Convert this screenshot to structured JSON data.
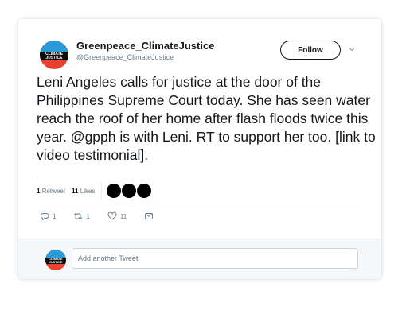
{
  "tweet": {
    "author": {
      "display_name": "Greenpeace_ClimateJustice",
      "handle": "@Greenpeace_ClimateJustice",
      "avatar_text": "CLIMATE JUSTICE"
    },
    "follow_label": "Follow",
    "text": "Leni Angeles calls for justice at the door of the Philippines Supreme Court today. She has seen water reach the roof of her home after flash floods twice this year. @gpph is with Leni. RT to support her too. [link to video testimonial].",
    "stats": {
      "retweets_count": "1",
      "retweets_label": "Retweet",
      "likes_count": "11",
      "likes_label": "Likes"
    },
    "likers_count": 3,
    "actions": {
      "reply_count": "1",
      "retweet_count": "1",
      "like_count": "11"
    }
  },
  "reply_box": {
    "placeholder": "Add another Tweet"
  },
  "icons": {
    "reply": "reply-icon",
    "retweet": "retweet-icon",
    "like": "heart-icon",
    "dm": "envelope-icon",
    "caret": "chevron-down-icon"
  },
  "colors": {
    "text": "#14171a",
    "muted": "#657786",
    "avatar_blue": "#2a9bd6",
    "avatar_red": "#e8412c"
  }
}
